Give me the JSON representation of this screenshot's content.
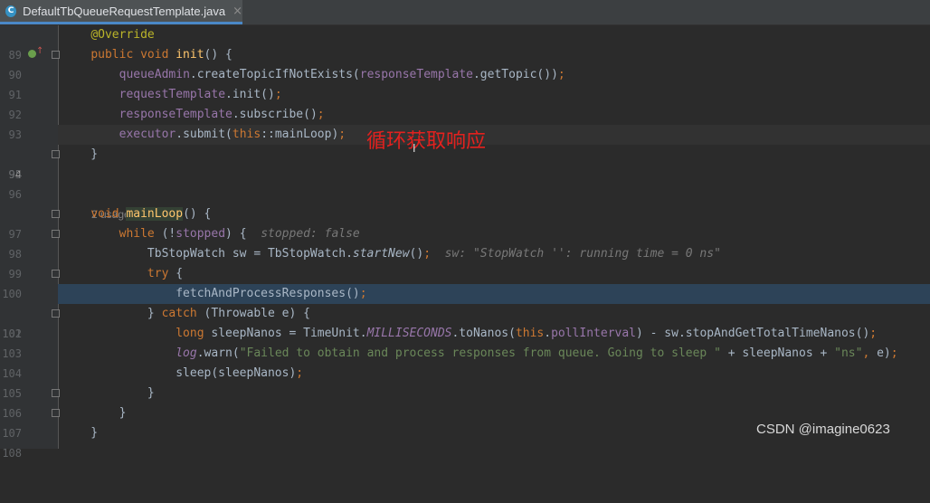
{
  "tab": {
    "filename": "DefaultTbQueueRequestTemplate.java",
    "icon": "C",
    "close": "×"
  },
  "usages_text": "2 usages",
  "lines": {
    "89": {
      "ln": "89"
    },
    "90": {
      "ln": "90"
    },
    "91": {
      "ln": "91"
    },
    "92": {
      "ln": "92"
    },
    "93": {
      "ln": "93"
    },
    "94": {
      "ln": "94"
    },
    "95": {
      "ln": "95"
    },
    "96": {
      "ln": "96"
    },
    "97": {
      "ln": "97"
    },
    "98": {
      "ln": "98",
      "hint": "stopped: false"
    },
    "99": {
      "ln": "99",
      "hint": "sw: \"StopWatch '': running time = 0 ns\""
    },
    "100": {
      "ln": "100"
    },
    "101": {
      "ln": "101"
    },
    "102": {
      "ln": "102"
    },
    "103": {
      "ln": "103"
    },
    "104": {
      "ln": "104",
      "log_message": "\"Failed to obtain and process responses from queue. Going to sleep \"",
      "ns_suffix": "\"ns\""
    },
    "105": {
      "ln": "105"
    },
    "106": {
      "ln": "106"
    },
    "107": {
      "ln": "107"
    },
    "108": {
      "ln": "108"
    }
  },
  "annotation_note": "循环获取响应",
  "watermark": "CSDN @imagine0623",
  "colors": {
    "background": "#2b2b2b",
    "keyword": "#cc7832",
    "method": "#ffc66d",
    "field": "#9876aa",
    "string": "#6a8759",
    "annotation_note": "#e3211e",
    "selection": "#2d4358"
  }
}
